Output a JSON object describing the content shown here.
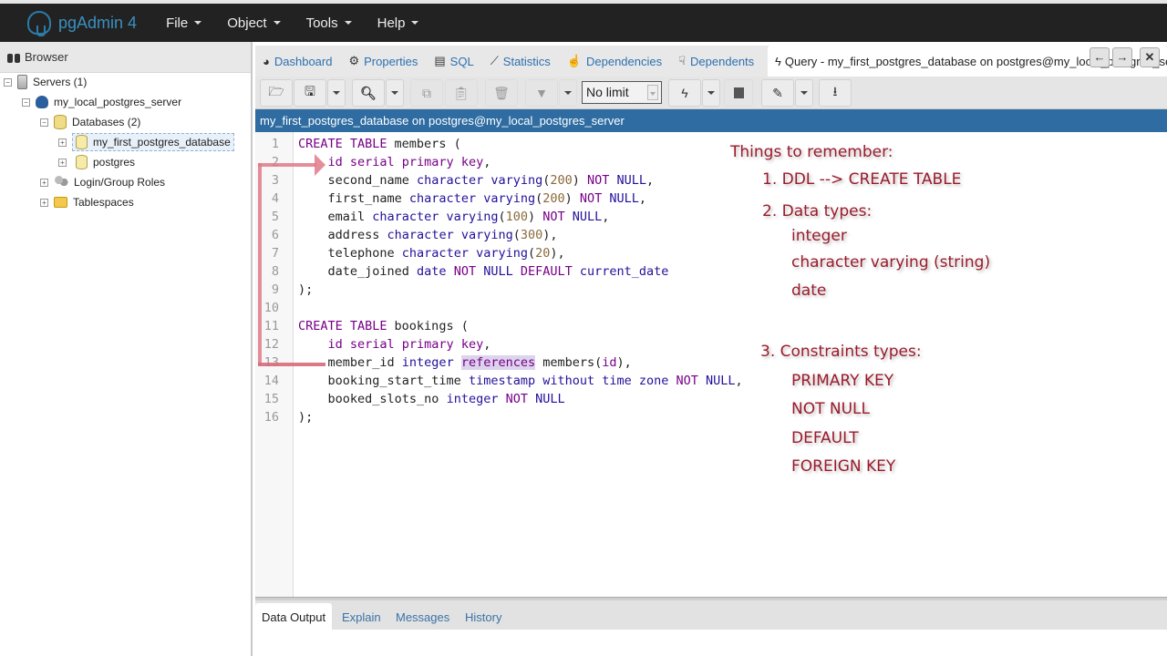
{
  "app": {
    "name": "pgAdmin 4"
  },
  "menu": [
    {
      "label": "File"
    },
    {
      "label": "Object"
    },
    {
      "label": "Tools"
    },
    {
      "label": "Help"
    }
  ],
  "browser": {
    "title": "Browser",
    "tree": [
      {
        "label": "Servers (1)",
        "icon": "server-icon",
        "toggle": "−"
      },
      {
        "label": "my_local_postgres_server",
        "icon": "postgres-elephant-icon",
        "toggle": "−"
      },
      {
        "label": "Databases (2)",
        "icon": "databases-icon",
        "toggle": "−"
      },
      {
        "label": "my_first_postgres_database",
        "icon": "database-icon",
        "toggle": "+",
        "selected": true
      },
      {
        "label": "postgres",
        "icon": "database-icon",
        "toggle": "+"
      },
      {
        "label": "Login/Group Roles",
        "icon": "roles-icon",
        "toggle": "+"
      },
      {
        "label": "Tablespaces",
        "icon": "tablespaces-icon",
        "toggle": "+"
      }
    ]
  },
  "panel_tabs": [
    {
      "label": "Dashboard",
      "icon": "dashboard-icon"
    },
    {
      "label": "Properties",
      "icon": "gears-icon"
    },
    {
      "label": "SQL",
      "icon": "file-icon"
    },
    {
      "label": "Statistics",
      "icon": "chart-icon"
    },
    {
      "label": "Dependencies",
      "icon": "hand-up-icon"
    },
    {
      "label": "Dependents",
      "icon": "hand-down-icon"
    }
  ],
  "query_tab": {
    "label": "Query - my_first_postgres_database on postgres@my_local_postgres_server",
    "icon": "bolt-icon"
  },
  "toolbar": {
    "limit": "No limit",
    "buttons": [
      "open-file",
      "save",
      "find",
      "copy",
      "paste",
      "delete",
      "filter",
      "execute",
      "stop",
      "edit",
      "download"
    ]
  },
  "connection": "my_first_postgres_database on postgres@my_local_postgres_server",
  "editor": {
    "line_numbers": [
      "1",
      "2",
      "3",
      "4",
      "5",
      "6",
      "7",
      "8",
      "9",
      "10",
      "11",
      "12",
      "13",
      "14",
      "15",
      "16"
    ],
    "lines": [
      [
        [
          "kw",
          "CREATE TABLE"
        ],
        [
          "",
          "members ("
        ]
      ],
      [
        [
          "",
          "    "
        ],
        [
          "kw",
          "id serial primary key"
        ],
        [
          "",
          ","
        ]
      ],
      [
        [
          "",
          "    second_name "
        ],
        [
          "ty",
          "character varying"
        ],
        [
          "",
          "("
        ],
        [
          "num",
          "200"
        ],
        [
          "",
          ") "
        ],
        [
          "kw",
          "NOT"
        ],
        [
          "ty",
          " NULL"
        ],
        [
          "",
          ","
        ]
      ],
      [
        [
          "",
          "    first_name "
        ],
        [
          "ty",
          "character varying"
        ],
        [
          "",
          "("
        ],
        [
          "num",
          "200"
        ],
        [
          "",
          ") "
        ],
        [
          "kw",
          "NOT"
        ],
        [
          "ty",
          " NULL"
        ],
        [
          "",
          ","
        ]
      ],
      [
        [
          "",
          "    email "
        ],
        [
          "ty",
          "character varying"
        ],
        [
          "",
          "("
        ],
        [
          "num",
          "100"
        ],
        [
          "",
          ") "
        ],
        [
          "kw",
          "NOT"
        ],
        [
          "ty",
          " NULL"
        ],
        [
          "",
          ","
        ]
      ],
      [
        [
          "",
          "    address "
        ],
        [
          "ty",
          "character varying"
        ],
        [
          "",
          "("
        ],
        [
          "num",
          "300"
        ],
        [
          "",
          "),"
        ]
      ],
      [
        [
          "",
          "    telephone "
        ],
        [
          "ty",
          "character varying"
        ],
        [
          "",
          "("
        ],
        [
          "num",
          "20"
        ],
        [
          "",
          "),"
        ]
      ],
      [
        [
          "",
          "    date_joined "
        ],
        [
          "ty",
          "date "
        ],
        [
          "kw",
          "NOT"
        ],
        [
          "ty",
          " NULL "
        ],
        [
          "kw",
          "DEFAULT"
        ],
        [
          "ty",
          " current_date"
        ]
      ],
      [
        [
          "",
          ");"
        ]
      ],
      [
        [
          "",
          ""
        ]
      ],
      [
        [
          "kw",
          "CREATE TABLE"
        ],
        [
          "",
          "bookings ("
        ]
      ],
      [
        [
          "",
          "    "
        ],
        [
          "kw",
          "id serial primary key"
        ],
        [
          "",
          ","
        ]
      ],
      [
        [
          "",
          "    member_id "
        ],
        [
          "ty",
          "integer "
        ],
        [
          "kwhl",
          "references"
        ],
        [
          "",
          " members("
        ],
        [
          "kw",
          "id"
        ],
        [
          "",
          "),"
        ]
      ],
      [
        [
          "",
          "    booking_start_time "
        ],
        [
          "ty",
          "timestamp without time zone "
        ],
        [
          "kw",
          "NOT"
        ],
        [
          "ty",
          " NULL"
        ],
        [
          "",
          ","
        ]
      ],
      [
        [
          "",
          "    booked_slots_no "
        ],
        [
          "ty",
          "integer "
        ],
        [
          "kw",
          "NOT"
        ],
        [
          "ty",
          " NULL"
        ]
      ],
      [
        [
          "",
          ");"
        ]
      ]
    ]
  },
  "notes": {
    "title": "Things to remember:",
    "item1": "1. DDL --> CREATE TABLE",
    "item2": "2. Data types:",
    "types": [
      "integer",
      "character varying (string)",
      "date"
    ],
    "item3": "3. Constraints types:",
    "constraints": [
      "PRIMARY KEY",
      "NOT NULL",
      "DEFAULT",
      "FOREIGN KEY"
    ]
  },
  "output_tabs": [
    {
      "label": "Data Output",
      "active": true
    },
    {
      "label": "Explain"
    },
    {
      "label": "Messages"
    },
    {
      "label": "History"
    }
  ]
}
